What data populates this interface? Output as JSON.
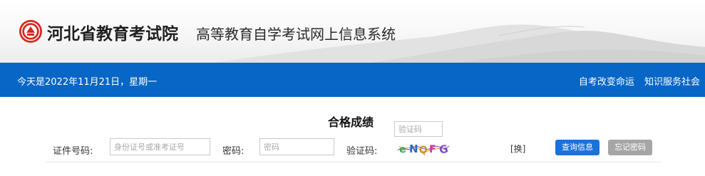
{
  "header": {
    "org_name": "河北省教育考试院",
    "system_name": "高等教育自学考试网上信息系统"
  },
  "bar": {
    "date_text": "今天是2022年11月21日，星期一",
    "links": [
      "自考改变命运",
      "知识服务社会"
    ]
  },
  "form": {
    "title": "合格成绩",
    "id_label": "证件号码:",
    "id_placeholder": "身份证号或准考证号",
    "password_label": "密码:",
    "password_placeholder": "密码",
    "captcha_label": "验证码:",
    "captcha_placeholder": "验证码",
    "refresh_label": "[换]",
    "query_button": "查询信息",
    "forgot_button": "忘记密码"
  },
  "colors": {
    "bar": "#0866c6",
    "query_button": "#1a73d9",
    "forgot_button": "#a6a6a6",
    "logo": "#d4261e"
  },
  "icons": {
    "logo": "exam-institute-seal-icon",
    "captcha": "captcha-image"
  }
}
